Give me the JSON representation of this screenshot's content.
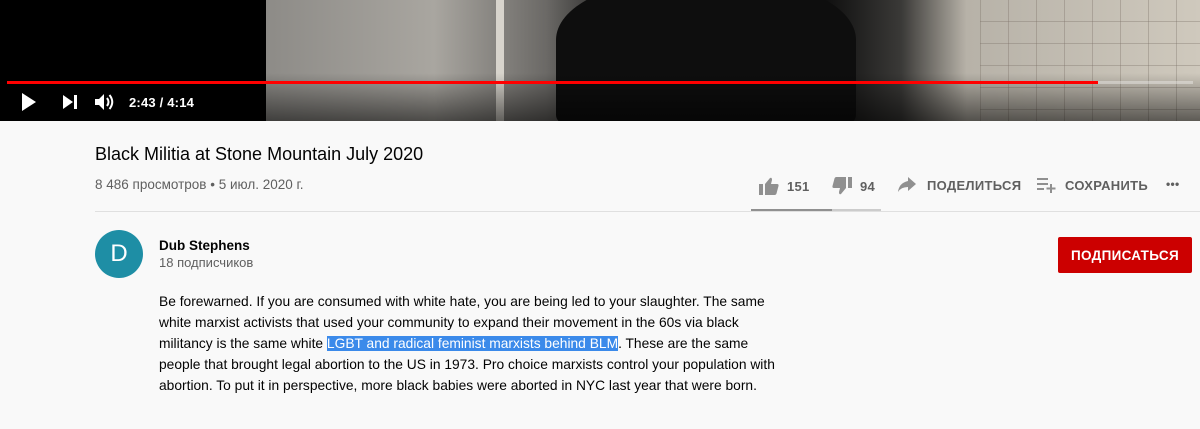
{
  "player": {
    "time_display": "2:43 / 4:14",
    "progress_fraction": 0.92,
    "colors": {
      "progress": "#ff0000",
      "track": "#ffffff"
    },
    "icons": [
      "play-icon",
      "next-icon",
      "volume-icon"
    ]
  },
  "video": {
    "title": "Black Militia at Stone Mountain July 2020",
    "views_date": "8 486 просмотров • 5 июл. 2020 г."
  },
  "actions": {
    "likes": "151",
    "dislikes": "94",
    "share_label": "ПОДЕЛИТЬСЯ",
    "save_label": "СОХРАНИТЬ",
    "more_label": "•••",
    "like_ratio": 0.62
  },
  "channel": {
    "avatar_letter": "D",
    "avatar_color": "#1e8ea5",
    "name": "Dub Stephens",
    "subscribers": "18 подписчиков",
    "subscribe_label": "ПОДПИСАТЬСЯ",
    "subscribe_color": "#cc0000"
  },
  "description": {
    "before_selection": "Be forewarned. If you are consumed with white hate, you are being led to your slaughter. The same white marxist activists that used your community to expand their movement in the 60s via black militancy is the same white ",
    "selected_text": "LGBT and radical feminist marxists behind BLM",
    "after_selection": ". These are the same people that brought legal abortion to the US in 1973. Pro choice marxists control your population with abortion. To put it in perspective, more black babies were aborted in NYC last year that were born.",
    "selection_color": "#3b8aea"
  }
}
